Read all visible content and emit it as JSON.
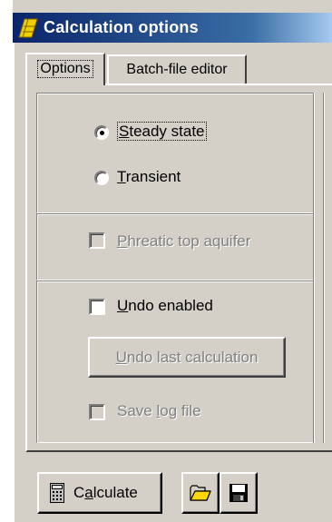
{
  "window": {
    "title": "Calculation options"
  },
  "tabs": [
    {
      "label": "Options",
      "active": true
    },
    {
      "label": "Batch-file editor",
      "active": false
    }
  ],
  "options": {
    "steady_state": {
      "pre": "",
      "accel": "S",
      "post": "teady state",
      "selected": true
    },
    "transient": {
      "pre": "",
      "accel": "T",
      "post": "ransient",
      "selected": false
    },
    "phreatic": {
      "pre": "",
      "accel": "P",
      "post": "hreatic top aquifer",
      "checked": false,
      "enabled": false
    },
    "undo_enabled": {
      "pre": "",
      "accel": "U",
      "post": "ndo enabled",
      "checked": false,
      "enabled": true
    },
    "undo_last": {
      "pre": "",
      "accel": "U",
      "post": "ndo last calculation",
      "enabled": false
    },
    "save_log": {
      "pre": "Save ",
      "accel": "l",
      "post": "og file",
      "checked": false,
      "enabled": false
    }
  },
  "toolbar": {
    "calculate": {
      "pre": "C",
      "accel": "a",
      "post": "lculate",
      "icon": "calculator-icon"
    },
    "open_icon": "open-folder-icon",
    "save_icon": "floppy-disk-icon"
  }
}
